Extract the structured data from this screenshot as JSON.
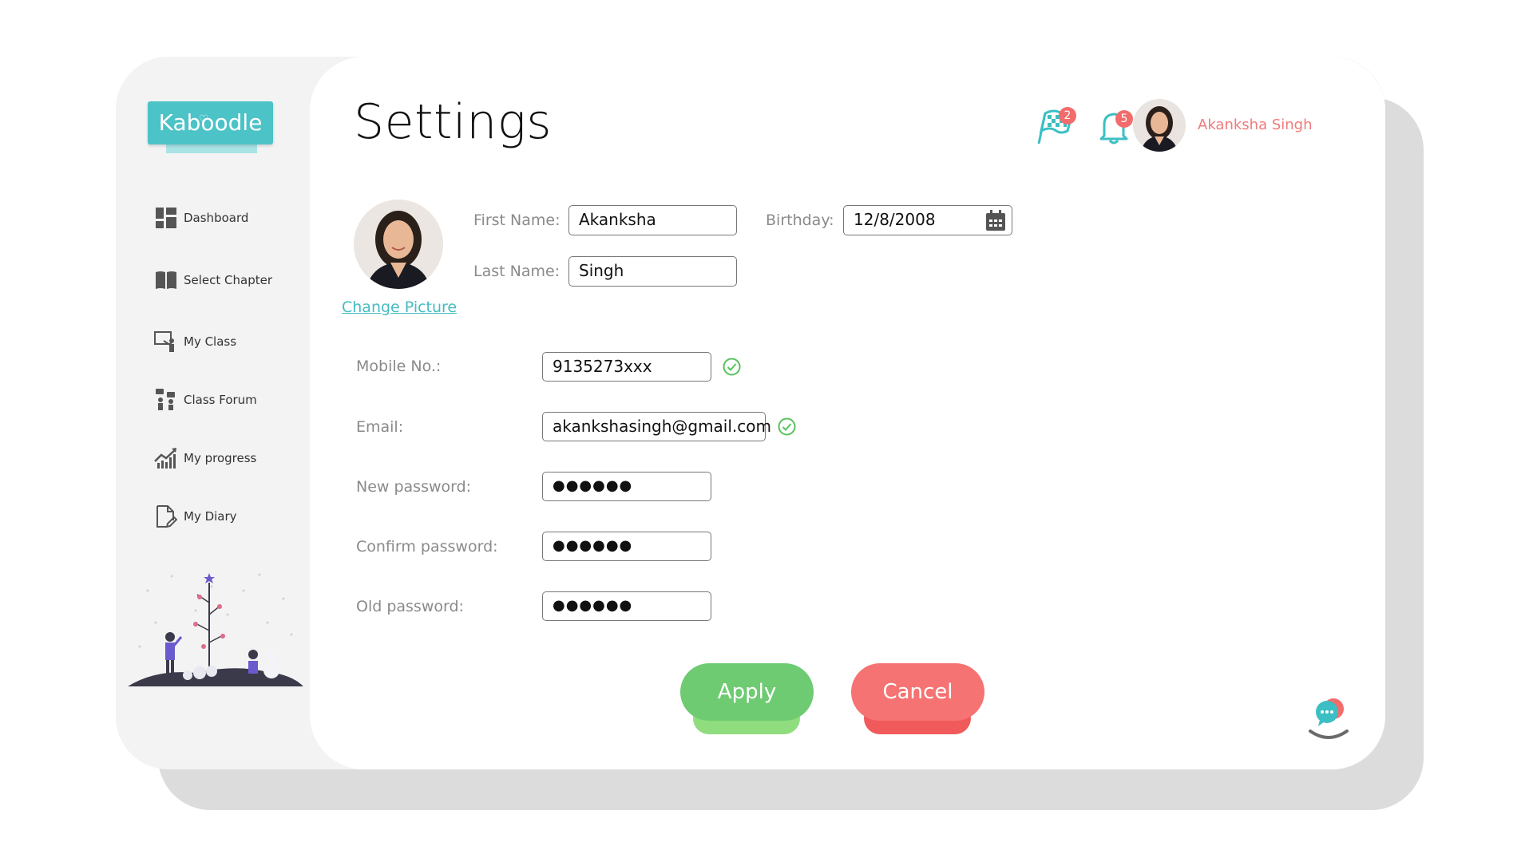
{
  "app": {
    "logo_text": "Kaboodle"
  },
  "sidebar": {
    "items": [
      {
        "label": "Dashboard",
        "icon": "dashboard-grid-icon"
      },
      {
        "label": "Select Chapter",
        "icon": "book-icon"
      },
      {
        "label": "My Class",
        "icon": "classroom-board-icon"
      },
      {
        "label": "Class Forum",
        "icon": "forum-people-icon"
      },
      {
        "label": "My progress",
        "icon": "progress-chart-icon"
      },
      {
        "label": "My Diary",
        "icon": "diary-edit-icon"
      }
    ]
  },
  "header": {
    "title": "Settings",
    "flag_badge": "2",
    "bell_badge": "5",
    "user_name": "Akanksha Singh"
  },
  "profile": {
    "change_picture_label": "Change Picture",
    "first_name_label": "First Name:",
    "first_name_value": "Akanksha",
    "last_name_label": "Last Name:",
    "last_name_value": "Singh",
    "birthday_label": "Birthday:",
    "birthday_value": "12/8/2008"
  },
  "form": {
    "mobile_label": "Mobile No.:",
    "mobile_value": "9135273xxx",
    "email_label": "Email:",
    "email_value": "akankshasingh@gmail.com",
    "new_password_label": "New password:",
    "new_password_value": "●●●●●●",
    "confirm_password_label": "Confirm password:",
    "confirm_password_value": "●●●●●●",
    "old_password_label": "Old password:",
    "old_password_value": "●●●●●●"
  },
  "actions": {
    "apply_label": "Apply",
    "cancel_label": "Cancel"
  },
  "colors": {
    "brand_teal": "#4bc3c7",
    "accent_coral": "#f26c6c",
    "apply_green": "#6fcb72",
    "cancel_red": "#f57373",
    "verified_green": "#58c25c"
  }
}
